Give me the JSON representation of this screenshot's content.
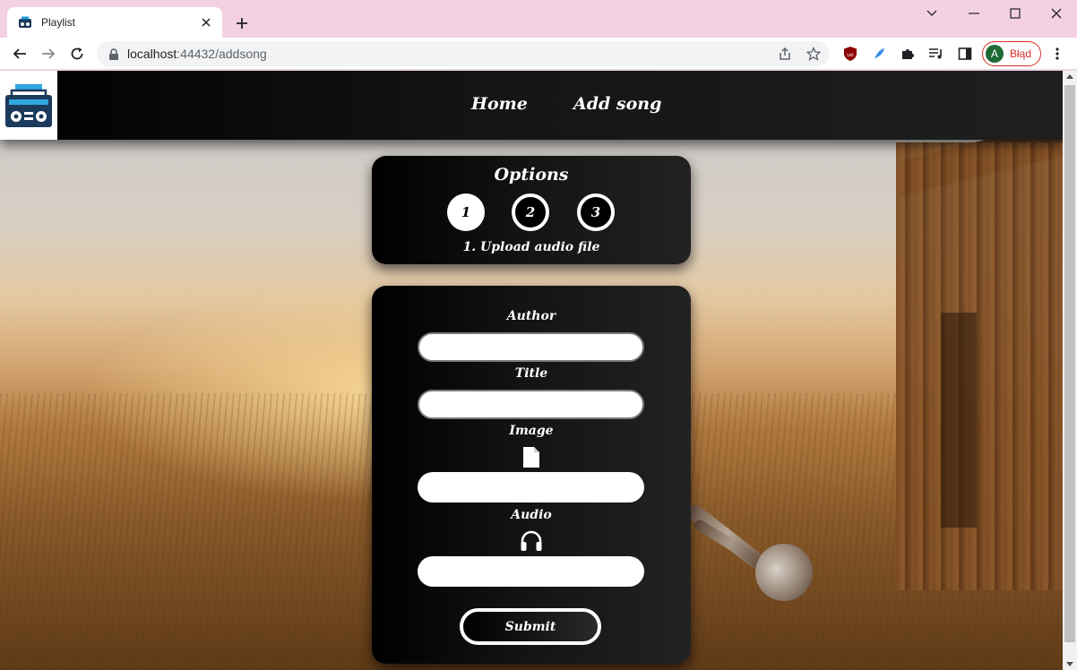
{
  "browser": {
    "tab_title": "Playlist",
    "url_host": "localhost",
    "url_rest": ":44432/addsong",
    "profile_initial": "A",
    "profile_status": "Błąd"
  },
  "header": {
    "nav": [
      {
        "label": "Home"
      },
      {
        "label": "Add song"
      }
    ]
  },
  "options": {
    "title": "Options",
    "steps": [
      {
        "label": "1",
        "active": true
      },
      {
        "label": "2",
        "active": false
      },
      {
        "label": "3",
        "active": false
      }
    ],
    "caption": "1. Upload audio file"
  },
  "form": {
    "author_label": "Author",
    "author_value": "",
    "title_label": "Title",
    "title_value": "",
    "image_label": "Image",
    "image_icon": "file-icon",
    "audio_label": "Audio",
    "audio_icon": "headphones-icon",
    "submit_label": "Submit"
  },
  "colors": {
    "browser_frame": "#f4d0e3",
    "header_bg": "#000000",
    "card_bg": "#111111",
    "accent_text": "#ffffff",
    "profile_error": "#d93025",
    "avatar_bg": "#1e6b34"
  }
}
